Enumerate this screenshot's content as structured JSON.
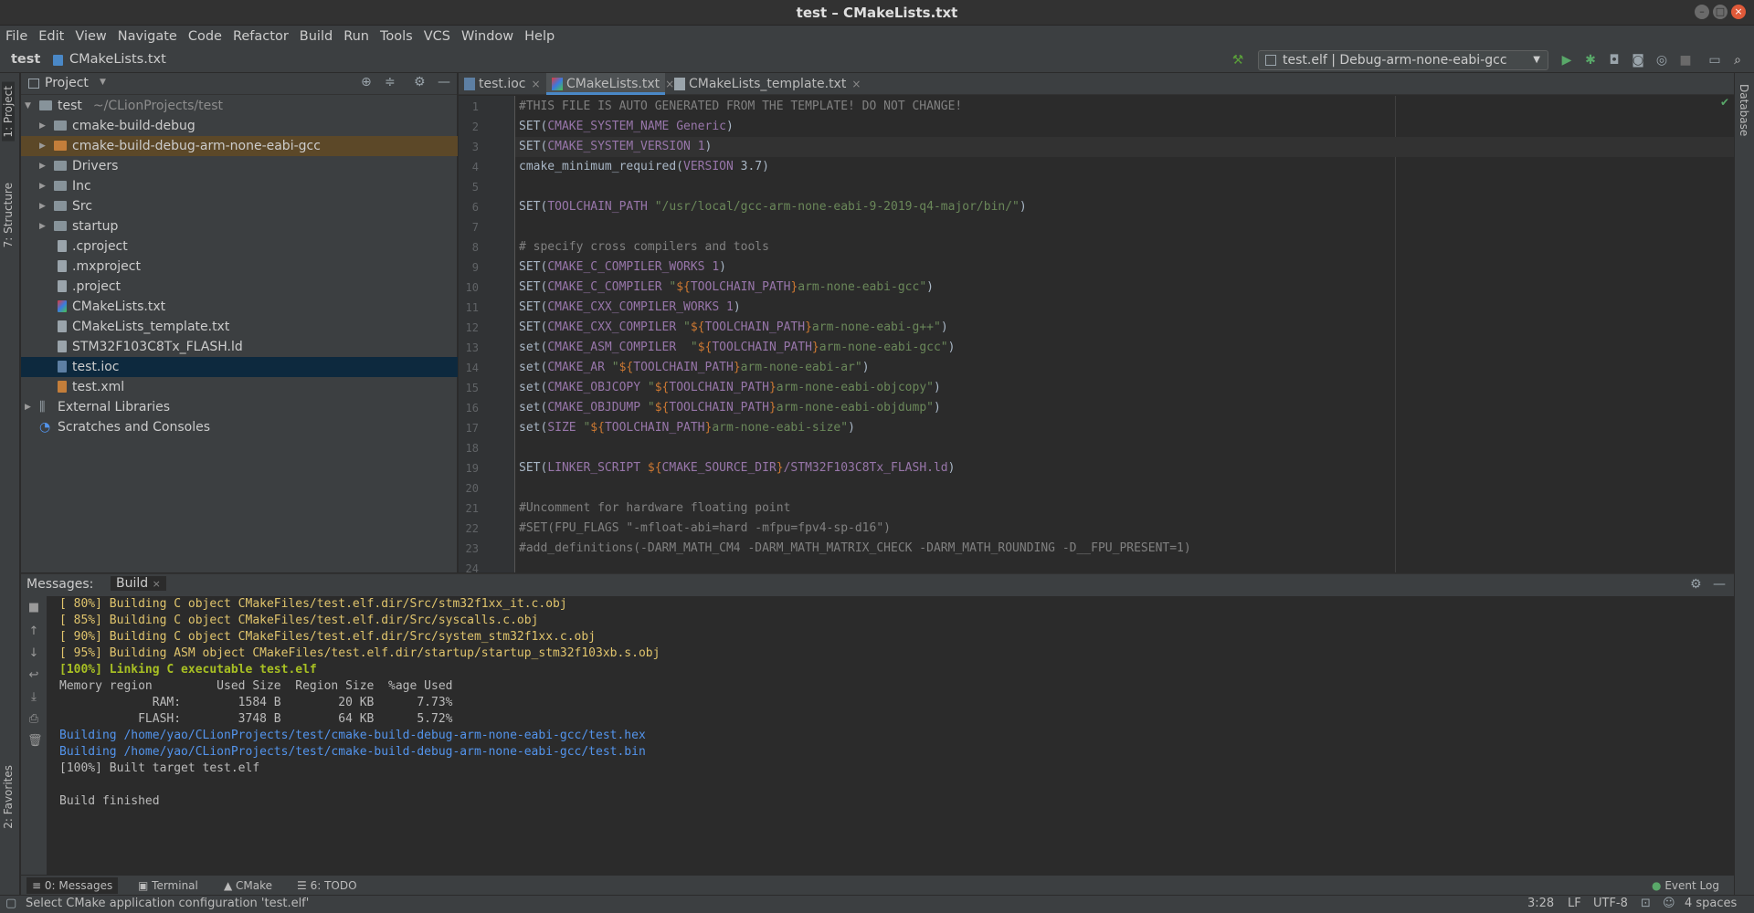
{
  "window": {
    "title": "test – CMakeLists.txt"
  },
  "menu": [
    "File",
    "Edit",
    "View",
    "Navigate",
    "Code",
    "Refactor",
    "Build",
    "Run",
    "Tools",
    "VCS",
    "Window",
    "Help"
  ],
  "breadcrumb": {
    "project": "test",
    "file": "CMakeLists.txt"
  },
  "run_config": {
    "label": "test.elf | Debug-arm-none-eabi-gcc"
  },
  "left_stripe": {
    "project": "1: Project",
    "structure": "7: Structure",
    "favorites": "2: Favorites"
  },
  "right_stripe": {
    "database": "Database"
  },
  "project_panel": {
    "title": "Project",
    "root": {
      "name": "test",
      "path": "~/CLionProjects/test"
    },
    "items": [
      {
        "label": "cmake-build-debug",
        "type": "folder"
      },
      {
        "label": "cmake-build-debug-arm-none-eabi-gcc",
        "type": "folder-excluded"
      },
      {
        "label": "Drivers",
        "type": "folder"
      },
      {
        "label": "Inc",
        "type": "folder"
      },
      {
        "label": "Src",
        "type": "folder"
      },
      {
        "label": "startup",
        "type": "folder"
      },
      {
        "label": ".cproject",
        "type": "file"
      },
      {
        "label": ".mxproject",
        "type": "file"
      },
      {
        "label": ".project",
        "type": "file"
      },
      {
        "label": "CMakeLists.txt",
        "type": "cmake"
      },
      {
        "label": "CMakeLists_template.txt",
        "type": "file"
      },
      {
        "label": "STM32F103C8Tx_FLASH.ld",
        "type": "file"
      },
      {
        "label": "test.ioc",
        "type": "file",
        "selected": true
      },
      {
        "label": "test.xml",
        "type": "file"
      }
    ],
    "external_libraries": "External Libraries",
    "scratches": "Scratches and Consoles"
  },
  "editor_tabs": [
    {
      "label": "test.ioc"
    },
    {
      "label": "CMakeLists.txt",
      "active": true
    },
    {
      "label": "CMakeLists_template.txt"
    }
  ],
  "code_lines": [
    "#THIS FILE IS AUTO GENERATED FROM THE TEMPLATE! DO NOT CHANGE!",
    "SET(CMAKE_SYSTEM_NAME Generic)",
    "SET(CMAKE_SYSTEM_VERSION 1)",
    "cmake_minimum_required(VERSION 3.7)",
    "",
    "SET(TOOLCHAIN_PATH \"/usr/local/gcc-arm-none-eabi-9-2019-q4-major/bin/\")",
    "",
    "# specify cross compilers and tools",
    "SET(CMAKE_C_COMPILER_WORKS 1)",
    "SET(CMAKE_C_COMPILER \"${TOOLCHAIN_PATH}arm-none-eabi-gcc\")",
    "SET(CMAKE_CXX_COMPILER_WORKS 1)",
    "SET(CMAKE_CXX_COMPILER \"${TOOLCHAIN_PATH}arm-none-eabi-g++\")",
    "set(CMAKE_ASM_COMPILER  \"${TOOLCHAIN_PATH}arm-none-eabi-gcc\")",
    "set(CMAKE_AR \"${TOOLCHAIN_PATH}arm-none-eabi-ar\")",
    "set(CMAKE_OBJCOPY \"${TOOLCHAIN_PATH}arm-none-eabi-objcopy\")",
    "set(CMAKE_OBJDUMP \"${TOOLCHAIN_PATH}arm-none-eabi-objdump\")",
    "set(SIZE \"${TOOLCHAIN_PATH}arm-none-eabi-size\")",
    "",
    "SET(LINKER_SCRIPT ${CMAKE_SOURCE_DIR}/STM32F103C8Tx_FLASH.ld)",
    "",
    "#Uncomment for hardware floating point",
    "#SET(FPU_FLAGS \"-mfloat-abi=hard -mfpu=fpv4-sp-d16\")",
    "#add_definitions(-DARM_MATH_CM4 -DARM_MATH_MATRIX_CHECK -DARM_MATH_ROUNDING -D__FPU_PRESENT=1)",
    ""
  ],
  "current_line": 3,
  "messages": {
    "title": "Messages:",
    "tab": "Build",
    "lines": [
      {
        "text": "[ 80%] Building C object CMakeFiles/test.elf.dir/Src/stm32f1xx_it.c.obj",
        "kind": "build"
      },
      {
        "text": "[ 85%] Building C object CMakeFiles/test.elf.dir/Src/syscalls.c.obj",
        "kind": "build"
      },
      {
        "text": "[ 90%] Building C object CMakeFiles/test.elf.dir/Src/system_stm32f1xx.c.obj",
        "kind": "build"
      },
      {
        "text": "[ 95%] Building ASM object CMakeFiles/test.elf.dir/startup/startup_stm32f103xb.s.obj",
        "kind": "build"
      },
      {
        "text": "[100%] Linking C executable test.elf",
        "kind": "link"
      },
      {
        "text": "Memory region         Used Size  Region Size  %age Used",
        "kind": "plain"
      },
      {
        "text": "             RAM:        1584 B        20 KB      7.73%",
        "kind": "plain"
      },
      {
        "text": "           FLASH:        3748 B        64 KB      5.72%",
        "kind": "plain"
      },
      {
        "text": "Building /home/yao/CLionProjects/test/cmake-build-debug-arm-none-eabi-gcc/test.hex",
        "kind": "path"
      },
      {
        "text": "Building /home/yao/CLionProjects/test/cmake-build-debug-arm-none-eabi-gcc/test.bin",
        "kind": "path"
      },
      {
        "text": "[100%] Built target test.elf",
        "kind": "plain"
      },
      {
        "text": "",
        "kind": "plain"
      },
      {
        "text": "Build finished",
        "kind": "plain"
      }
    ]
  },
  "tool_windows": [
    {
      "label": "0: Messages",
      "active": true
    },
    {
      "label": "Terminal"
    },
    {
      "label": "CMake"
    },
    {
      "label": "6: TODO"
    }
  ],
  "event_log": "Event Log",
  "status": {
    "message": "Select CMake application configuration 'test.elf'",
    "position": "3:28",
    "line_sep": "LF",
    "encoding": "UTF-8",
    "indent": "4 spaces"
  }
}
